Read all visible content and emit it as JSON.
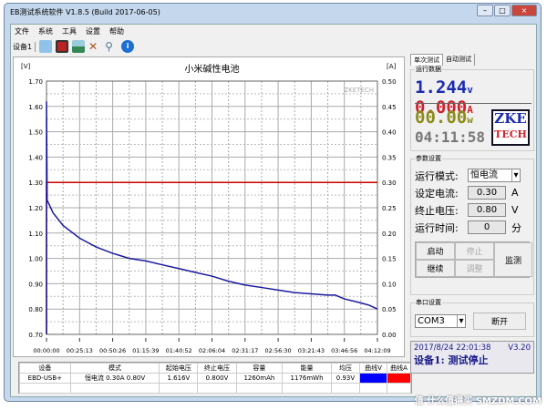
{
  "window": {
    "title": "EB测试系统软件 V1.8.5 (Build 2017-06-05)",
    "buttons": [
      "–",
      "□",
      "×"
    ]
  },
  "menu": [
    "文件",
    "系统",
    "工具",
    "设置",
    "帮助"
  ],
  "toolbar": {
    "device": "设备1",
    "icons": [
      "folder-icon",
      "save-icon",
      "image-icon",
      "tools-icon",
      "search-icon",
      "info-icon"
    ]
  },
  "chart_data": {
    "type": "line",
    "title": "小米碱性电池",
    "watermark": "ZKETECH",
    "ylabel": "[V]",
    "y2label": "[A]",
    "ylim": [
      0.7,
      1.7
    ],
    "y2lim": [
      0,
      0.5
    ],
    "yticks": [
      "1.70",
      "1.60",
      "1.50",
      "1.40",
      "1.30",
      "1.20",
      "1.10",
      "1.00",
      "0.90",
      "0.80",
      "0.70"
    ],
    "y2ticks": [
      "0.50",
      "0.45",
      "0.40",
      "0.35",
      "0.30",
      "0.25",
      "0.20",
      "0.15",
      "0.10",
      "0.05",
      "0.00"
    ],
    "xticks": [
      "00:00:00",
      "00:25:13",
      "00:50:26",
      "01:15:39",
      "01:40:52",
      "02:06:04",
      "02:31:17",
      "02:56:30",
      "03:21:43",
      "03:46:56",
      "04:12:09"
    ],
    "xlim_minutes": [
      0,
      252.15
    ],
    "grid": true,
    "series": [
      {
        "axis": "left",
        "color": "#1a1aa0",
        "x_minutes": [
          0,
          0,
          0.5,
          5,
          12.6,
          25.2,
          37.8,
          50.4,
          63,
          75.6,
          88,
          100.8,
          113,
          126,
          138.6,
          151,
          164,
          176.5,
          189,
          201.7,
          214,
          220,
          227,
          239,
          246,
          252.15
        ],
        "values": [
          0.7,
          1.62,
          1.23,
          1.18,
          1.13,
          1.08,
          1.045,
          1.02,
          1.0,
          0.99,
          0.975,
          0.96,
          0.945,
          0.93,
          0.91,
          0.895,
          0.885,
          0.875,
          0.865,
          0.86,
          0.855,
          0.855,
          0.84,
          0.825,
          0.815,
          0.8
        ]
      },
      {
        "axis": "right",
        "color": "#cc0000",
        "x_minutes": [
          0,
          0,
          252.15
        ],
        "values": [
          0,
          0.3,
          0.3
        ]
      }
    ]
  },
  "table": {
    "headers": [
      "设备",
      "模式",
      "起始电压",
      "终止电压",
      "容量",
      "能量",
      "均压",
      "曲线V",
      "曲线A"
    ],
    "row": [
      "EBD-USB+",
      "恒电流 0.30A 0.80V",
      "1.616V",
      "0.800V",
      "1260mAh",
      "1176mWh",
      "0.93V"
    ],
    "colors": [
      "#0000ff",
      "#ff0000"
    ]
  },
  "panel": {
    "tabs": [
      "单次测试",
      "自动测试"
    ],
    "run_title": "运行数据",
    "voltage": "1.244",
    "v_unit": "v",
    "current": "0.000",
    "a_unit": "A",
    "power": "00.00",
    "w_unit": "w",
    "time": "04:11:58",
    "logo": [
      "ZKE",
      "TECH"
    ],
    "param_title": "参数设置",
    "mode_label": "运行模式:",
    "mode_value": "恒电流",
    "current_label": "设定电流:",
    "current_value": "0.30",
    "current_unit": "A",
    "stop_label": "终止电压:",
    "stop_value": "0.80",
    "stop_unit": "V",
    "time_label": "运行时间:",
    "time_value": "0",
    "time_unit": "分",
    "btn_start": "启动",
    "btn_stop": "停止",
    "btn_continue": "继续",
    "btn_adjust": "调整",
    "btn_monitor": "监测",
    "port_title": "串口设置",
    "port": "COM3",
    "disconnect": "断开",
    "status_time": "2017/8/24 22:01:38",
    "status_ver": "V3.20",
    "status": "设备1: 测试停止"
  },
  "watermark": "值 什么值得买 SMZDM.COM"
}
